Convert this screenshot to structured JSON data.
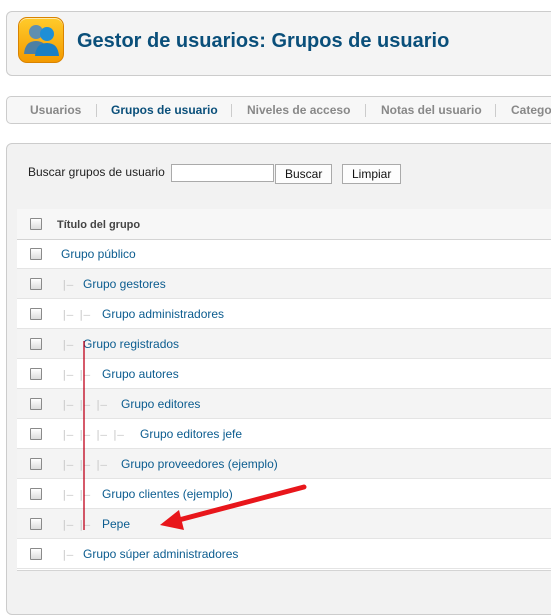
{
  "header": {
    "title": "Gestor de usuarios: Grupos de usuario",
    "icon": "users-icon"
  },
  "tabs": [
    {
      "label": "Usuarios",
      "active": false
    },
    {
      "label": "Grupos de usuario",
      "active": true
    },
    {
      "label": "Niveles de acceso",
      "active": false
    },
    {
      "label": "Notas del usuario",
      "active": false
    },
    {
      "label": "Catego",
      "active": false
    }
  ],
  "search": {
    "label": "Buscar grupos de usuario",
    "value": "",
    "search_button": "Buscar",
    "clear_button": "Limpiar"
  },
  "table": {
    "column_title": "Título del grupo",
    "rows": [
      {
        "title": "Grupo público",
        "level": 0,
        "prefix": ""
      },
      {
        "title": "Grupo gestores",
        "level": 1,
        "prefix": "|—"
      },
      {
        "title": "Grupo administradores",
        "level": 2,
        "prefix": "|— |—"
      },
      {
        "title": "Grupo registrados",
        "level": 1,
        "prefix": "|—"
      },
      {
        "title": "Grupo autores",
        "level": 2,
        "prefix": "|— |—"
      },
      {
        "title": "Grupo editores",
        "level": 3,
        "prefix": "|— |— |—"
      },
      {
        "title": "Grupo editores jefe",
        "level": 4,
        "prefix": "|— |— |— |—"
      },
      {
        "title": "Grupo proveedores (ejemplo)",
        "level": 3,
        "prefix": "|— |— |—"
      },
      {
        "title": "Grupo clientes (ejemplo)",
        "level": 2,
        "prefix": "|— |—"
      },
      {
        "title": "Pepe",
        "level": 2,
        "prefix": "|— |—"
      },
      {
        "title": "Grupo súper administradores",
        "level": 1,
        "prefix": "|—"
      }
    ]
  },
  "colors": {
    "title": "#0a4f7a",
    "link": "#0b5c8f",
    "annotation_arrow": "#e8161b",
    "annotation_line": "#c0001a"
  }
}
